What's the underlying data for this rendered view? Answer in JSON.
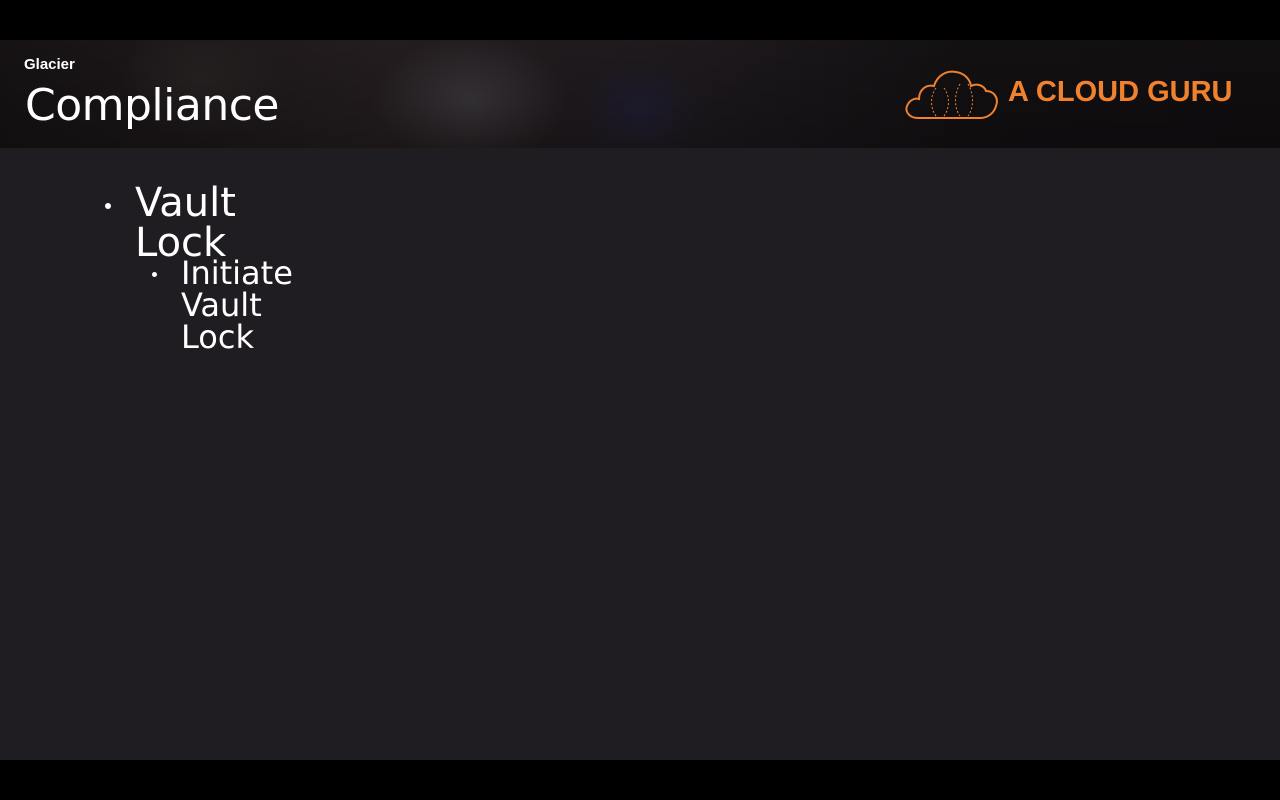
{
  "header": {
    "subtitle": "Glacier",
    "title": "Compliance"
  },
  "logo": {
    "text": "A CLOUD GURU",
    "icon": "cloud-icon",
    "color": "#f0812e"
  },
  "bullets": [
    {
      "text": "Vault Lock",
      "level": 1
    },
    {
      "text": "Initiate Vault Lock",
      "level": 2
    }
  ],
  "colors": {
    "slide_background": "#1f1d21",
    "text": "#ffffff",
    "accent": "#f0812e"
  }
}
